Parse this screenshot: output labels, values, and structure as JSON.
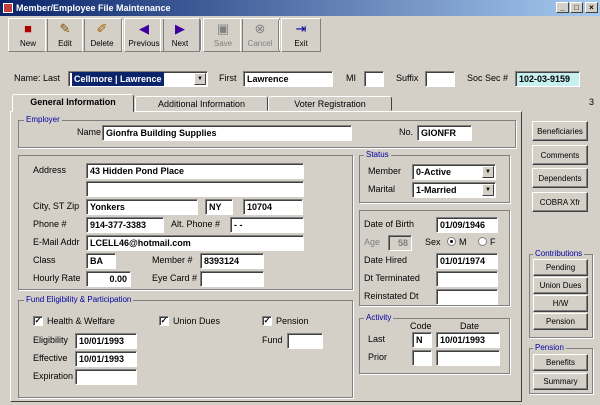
{
  "window": {
    "title": "Member/Employee File Maintenance",
    "min": "_",
    "max": "□",
    "close": "×"
  },
  "toolbar": {
    "new": "New",
    "edit": "Edit",
    "delete": "Delete",
    "previous": "Previous",
    "next": "Next",
    "save": "Save",
    "cancel": "Cancel",
    "exit": "Exit"
  },
  "header": {
    "name_last_label": "Name: Last",
    "name_last": "Cellmore | Lawrence",
    "first_label": "First",
    "first": "Lawrence",
    "mi_label": "MI",
    "mi": "",
    "suffix_label": "Suffix",
    "suffix": "",
    "ssn_label": "Soc Sec #",
    "ssn": "102-03-9159",
    "page_num": "3"
  },
  "tabs": [
    "General Information",
    "Additional Information",
    "Voter Registration"
  ],
  "employer": {
    "group": "Employer",
    "name_label": "Name",
    "name": "Gionfra Building Supplies",
    "no_label": "No.",
    "no": "GIONFR"
  },
  "address": {
    "address_label": "Address",
    "line1": "43 Hidden Pond Place",
    "line2": "",
    "city_label": "City, ST Zip",
    "city": "Yonkers",
    "state": "NY",
    "zip": "10704",
    "phone_label": "Phone #",
    "phone": "914-377-3383",
    "alt_phone_label": "Alt. Phone #",
    "alt_phone": "-    -",
    "email_label": "E-Mail Addr",
    "email": "LCELL46@hotmail.com",
    "class_label": "Class",
    "class": "BA",
    "member_label": "Member #",
    "member": "8393124",
    "rate_label": "Hourly Rate",
    "rate": "0.00",
    "eye_label": "Eye Card #",
    "eye": ""
  },
  "fund": {
    "group": "Fund Eligibility & Participation",
    "health": "Health & Welfare",
    "union": "Union Dues",
    "pension": "Pension",
    "eligibility_label": "Eligibility",
    "eligibility": "10/01/1993",
    "effective_label": "Effective",
    "effective": "10/01/1993",
    "expiration_label": "Expiration",
    "expiration": "",
    "fund_label": "Fund",
    "fund": ""
  },
  "status": {
    "group": "Status",
    "member_label": "Member",
    "member": "0-Active",
    "marital_label": "Marital",
    "marital": "1-Married"
  },
  "dates": {
    "dob_label": "Date of Birth",
    "dob": "01/09/1946",
    "age_label": "Age",
    "age": "58",
    "sex_label": "Sex",
    "m": "M",
    "f": "F",
    "hired_label": "Date Hired",
    "hired": "01/01/1974",
    "term_label": "Dt Terminated",
    "term": "",
    "reinst_label": "Reinstated Dt",
    "reinst": ""
  },
  "activity": {
    "group": "Activity",
    "code_header": "Code",
    "date_header": "Date",
    "last_label": "Last",
    "last_code": "N",
    "last_date": "10/01/1993",
    "prior_label": "Prior",
    "prior_code": "",
    "prior_date": ""
  },
  "side": {
    "beneficiaries": "Beneficiaries",
    "comments": "Comments",
    "dependents": "Dependents",
    "cobra": "COBRA Xfr",
    "contrib_group": "Contributions",
    "pending": "Pending",
    "union_dues": "Union Dues",
    "hw": "H/W",
    "pension": "Pension",
    "pension_group": "Pension",
    "benefits": "Benefits",
    "summary": "Summary"
  }
}
